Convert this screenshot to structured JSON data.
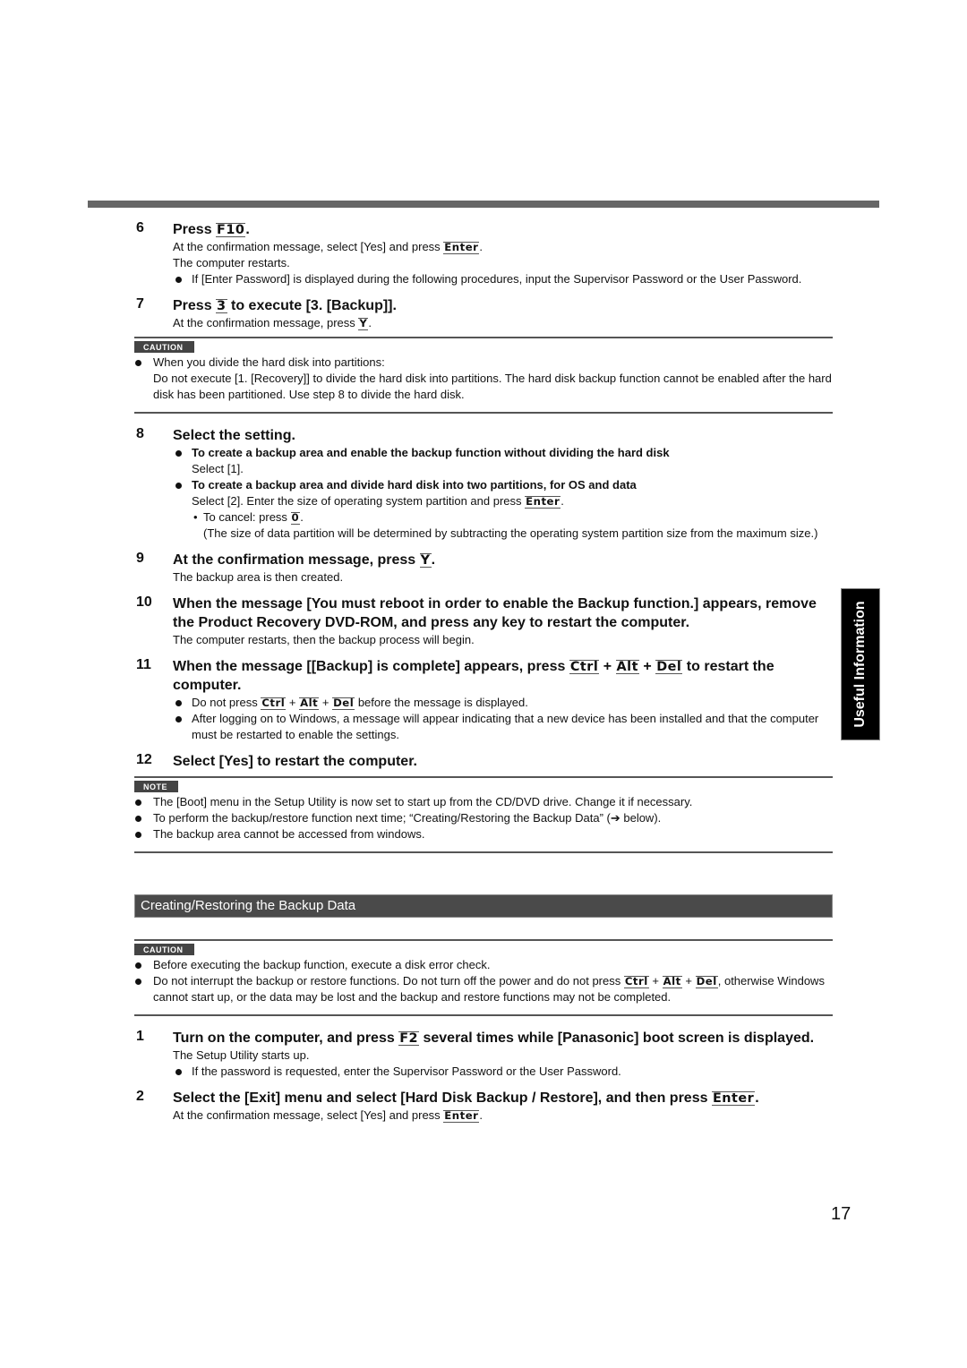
{
  "page_number": "17",
  "side_tab": "Useful Information",
  "colors": {
    "top_bar": "#666666",
    "section_bar": "#4a4a4a",
    "tag_bg": "#444444",
    "side_tab_bg": "#000000"
  },
  "steps_a": [
    {
      "num": "6",
      "title_pre": "Press ",
      "title_key": "F10",
      "title_post": ".",
      "body": [
        {
          "pre": "At the confirmation message, select [Yes] and press ",
          "key": "Enter",
          "post": "."
        },
        {
          "pre": "The computer restarts.",
          "key": "",
          "post": ""
        }
      ],
      "bullets": [
        "If [Enter Password] is displayed during the following procedures, input the Supervisor Password or the User Password."
      ]
    },
    {
      "num": "7",
      "title_pre": "Press ",
      "title_key": "3",
      "title_post": " to execute [3. [Backup]].",
      "body": [
        {
          "pre": "At the confirmation message, press ",
          "key": "Y",
          "post": "."
        }
      ]
    }
  ],
  "caution1": {
    "tag": "CAUTION",
    "items": [
      {
        "line1": "When you divide the hard disk into partitions:",
        "line2": "Do not execute [1. [Recovery]] to divide the hard disk into partitions. The hard disk backup function cannot be enabled after the hard disk has been partitioned. Use step 8 to divide the hard disk."
      }
    ]
  },
  "step8": {
    "num": "8",
    "title": "Select the setting.",
    "opt1_bold": "To create a backup area and enable the backup function without dividing the hard disk",
    "opt1_text": "Select [1].",
    "opt2_bold": "To create a backup area and divide hard disk into two partitions, for OS and data",
    "opt2_pre": "Select [2]. Enter the size of operating system partition and press ",
    "opt2_key": "Enter",
    "opt2_post": ".",
    "cancel_pre": "To cancel: press ",
    "cancel_key": "0",
    "cancel_post": ".",
    "cancel_note": "(The size of data partition will be determined by subtracting the operating system partition size from the maximum size.)"
  },
  "step9": {
    "num": "9",
    "title_pre": "At the confirmation message, press ",
    "title_key": "Y",
    "title_post": ".",
    "body": "The backup area is then created."
  },
  "step10": {
    "num": "10",
    "title": "When the message [You must reboot in order to enable the Backup function.] appears, remove the Product Recovery DVD-ROM, and press any key to restart the computer.",
    "body": "The computer restarts, then the backup process will begin."
  },
  "step11": {
    "num": "11",
    "title_pre": "When the message [[Backup] is complete] appears, press ",
    "k1": "Ctrl",
    "k2": "Alt",
    "k3": "Del",
    "plus": " + ",
    "title_post": " to restart the computer.",
    "b1_pre": "Do not press ",
    "b1_post": " before the message is displayed.",
    "b2": "After logging on to Windows, a message will appear indicating that a new device has been installed and that the computer must be restarted to enable the settings."
  },
  "step12": {
    "num": "12",
    "title": "Select [Yes] to restart the computer."
  },
  "note": {
    "tag": "NOTE",
    "items": [
      "The [Boot] menu in the Setup Utility is now set to start up from the CD/DVD drive. Change it if necessary.",
      "To perform the backup/restore function next time; “Creating/Restoring the Backup Data” (➔ below).",
      "The backup area cannot be accessed from windows."
    ]
  },
  "section_title": "Creating/Restoring the Backup Data",
  "caution2": {
    "tag": "CAUTION",
    "item1": "Before executing the backup function, execute a disk error check.",
    "item2_pre": "Do not interrupt the backup or restore functions. Do not turn off the power and do not press ",
    "k1": "Ctrl",
    "k2": "Alt",
    "k3": "Del",
    "plus": " + ",
    "item2_post": ", otherwise Windows cannot start up, or the data may be lost and the backup and restore functions may not be completed."
  },
  "steps_b": {
    "s1": {
      "num": "1",
      "title_pre": "Turn on the computer, and press ",
      "title_key": "F2",
      "title_post": " several times while [Panasonic] boot screen is displayed.",
      "body": "The Setup Utility starts up.",
      "bullet": "If the password is requested, enter the Supervisor Password or the User Password."
    },
    "s2": {
      "num": "2",
      "title_pre": "Select the [Exit] menu and select [Hard Disk Backup / Restore], and then press ",
      "title_key": "Enter",
      "title_post": ".",
      "body_pre": "At the confirmation message, select [Yes] and press ",
      "body_key": "Enter",
      "body_post": "."
    }
  }
}
